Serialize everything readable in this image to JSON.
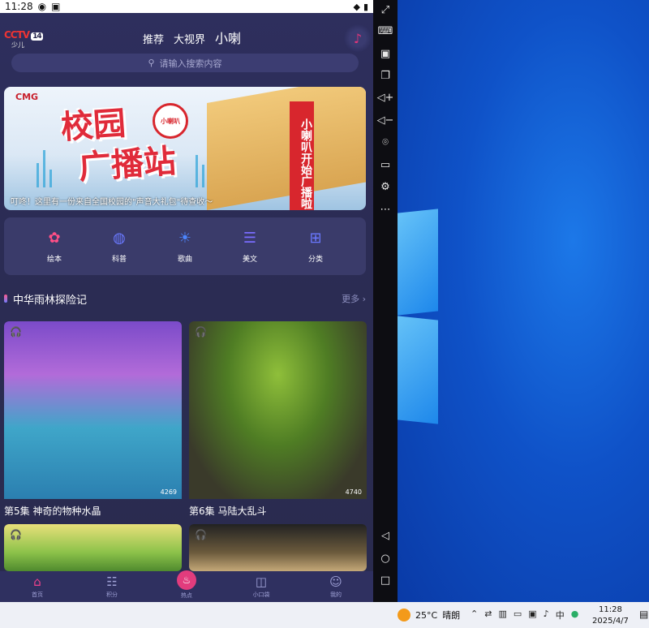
{
  "status_bar": {
    "time": "11:28",
    "left_icons": [
      "wechat-icon",
      "notification-icon"
    ],
    "right_icons": [
      "wifi-icon",
      "battery-icon"
    ]
  },
  "app": {
    "logo": {
      "brand": "CCTV",
      "channel": "14",
      "sub": "少儿"
    },
    "nav_tabs": [
      {
        "label": "推荐",
        "active": false
      },
      {
        "label": "大视界",
        "active": false
      },
      {
        "label": "小喇",
        "active": true
      }
    ],
    "search": {
      "placeholder": "请输入搜索内容"
    },
    "banner": {
      "brand": "CMG",
      "title_line1": "校园",
      "title_line2": "广播站",
      "pillar_text": "小喇叭开始广播啦",
      "mascot": "小喇叭",
      "caption": "叮咚！这里有一份来自全国校园的\"声音大礼包\"待查收～"
    },
    "categories": [
      {
        "label": "绘本",
        "icon": "tulip-icon",
        "color": "#ff4f86"
      },
      {
        "label": "科普",
        "icon": "planet-icon",
        "color": "#6a79ff"
      },
      {
        "label": "歌曲",
        "icon": "bulb-icon",
        "color": "#4c86ff"
      },
      {
        "label": "美文",
        "icon": "document-icon",
        "color": "#7a6cff"
      },
      {
        "label": "分类",
        "icon": "grid-icon",
        "color": "#6a78ff"
      }
    ],
    "section": {
      "title": "中华雨林探险记",
      "more": "更多 ›"
    },
    "cards": [
      {
        "title": "第5集 神奇的物种水晶",
        "count": "4269",
        "theme": "crystal"
      },
      {
        "title": "第6集 马陆大乱斗",
        "count": "4740",
        "theme": "millipede"
      },
      {
        "title": "",
        "count": "",
        "theme": "forest"
      },
      {
        "title": "",
        "count": "",
        "theme": "basket"
      }
    ],
    "tab_bar": [
      {
        "label": "首页",
        "icon": "home-icon",
        "active": true
      },
      {
        "label": "积分",
        "icon": "coins-icon",
        "active": false
      },
      {
        "label": "热点",
        "icon": "flame-icon",
        "active": false
      },
      {
        "label": "小口袋",
        "icon": "pocket-icon",
        "active": false
      },
      {
        "label": "我的",
        "icon": "user-icon",
        "active": false
      }
    ]
  },
  "emulator_toolbar": [
    "fullscreen-icon",
    "keyboard-icon",
    "screenshot-icon",
    "multi-window-icon",
    "volume-up-icon",
    "volume-down-icon",
    "location-icon",
    "folder-icon",
    "settings-icon",
    "more-icon",
    "back-icon",
    "home-icon",
    "recent-apps-icon"
  ],
  "taskbar": {
    "weather_temp": "25°C",
    "weather_text": "晴朗",
    "ime": "中",
    "time": "11:28",
    "date": "2025/4/7"
  }
}
